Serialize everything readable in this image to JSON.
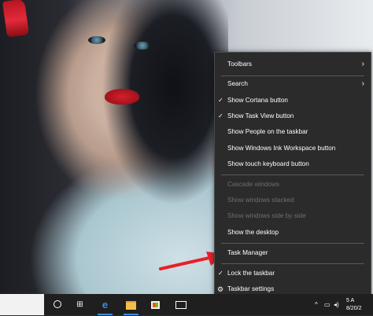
{
  "context_menu": {
    "items": [
      {
        "label": "Toolbars",
        "checked": false,
        "submenu": true,
        "disabled": false
      },
      {
        "label": "Search",
        "checked": false,
        "submenu": true,
        "disabled": false
      },
      {
        "label": "Show Cortana button",
        "checked": true,
        "submenu": false,
        "disabled": false
      },
      {
        "label": "Show Task View button",
        "checked": true,
        "submenu": false,
        "disabled": false
      },
      {
        "label": "Show People on the taskbar",
        "checked": false,
        "submenu": false,
        "disabled": false
      },
      {
        "label": "Show Windows Ink Workspace button",
        "checked": false,
        "submenu": false,
        "disabled": false
      },
      {
        "label": "Show touch keyboard button",
        "checked": false,
        "submenu": false,
        "disabled": false
      },
      {
        "label": "Cascade windows",
        "checked": false,
        "submenu": false,
        "disabled": true
      },
      {
        "label": "Show windows stacked",
        "checked": false,
        "submenu": false,
        "disabled": true
      },
      {
        "label": "Show windows side by side",
        "checked": false,
        "submenu": false,
        "disabled": true
      },
      {
        "label": "Show the desktop",
        "checked": false,
        "submenu": false,
        "disabled": false
      },
      {
        "label": "Task Manager",
        "checked": false,
        "submenu": false,
        "disabled": false
      },
      {
        "label": "Lock the taskbar",
        "checked": true,
        "submenu": false,
        "disabled": false
      },
      {
        "label": "Taskbar settings",
        "checked": false,
        "submenu": false,
        "disabled": false,
        "icon": "gear-icon"
      }
    ],
    "check_glyph": "✓",
    "chevron_glyph": "›",
    "gear_glyph": "⚙"
  },
  "taskbar": {
    "icons": [
      "cortana-icon",
      "task-view-icon",
      "edge-icon",
      "file-explorer-icon",
      "store-icon",
      "mail-icon"
    ],
    "edge_glyph": "e",
    "taskview_glyph": "⊞",
    "tray": {
      "chevron": "^",
      "clock_time": "5 A",
      "clock_date": "8/20/2"
    },
    "accent": "#3a8de0"
  },
  "annotation": {
    "arrow_color": "#e8202a",
    "points_to": "Task Manager"
  }
}
